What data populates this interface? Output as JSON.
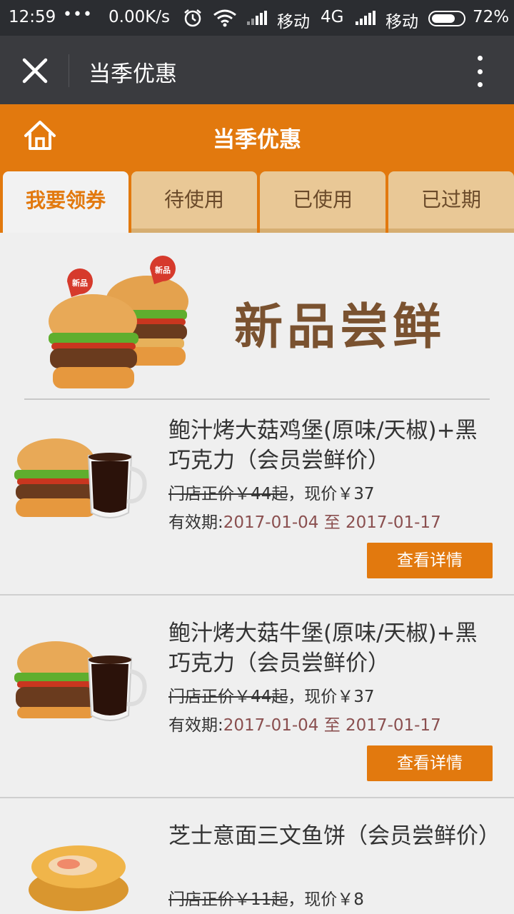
{
  "status_bar": {
    "time": "12:59",
    "dots": "•••",
    "speed": "0.00K/s",
    "carrier1": "移动",
    "network": "4G",
    "carrier2": "移动",
    "battery": "72%"
  },
  "webview": {
    "title": "当季优惠"
  },
  "page_header": {
    "title": "当季优惠"
  },
  "tabs": [
    {
      "label": "我要领券",
      "active": true
    },
    {
      "label": "待使用",
      "active": false
    },
    {
      "label": "已使用",
      "active": false
    },
    {
      "label": "已过期",
      "active": false
    }
  ],
  "banner": {
    "text": "新品尝鲜",
    "badge": "新品"
  },
  "products": [
    {
      "name": "鲍汁烤大菇鸡堡(原味/天椒)+黑巧克力（会员尝鲜价）",
      "old_price": "门店正价￥44起",
      "sep": "，",
      "new_price": "现价￥37",
      "validity_label": "有效期:",
      "validity_dates": "2017-01-04 至 2017-01-17",
      "button": "查看详情"
    },
    {
      "name": "鲍汁烤大菇牛堡(原味/天椒)+黑巧克力（会员尝鲜价）",
      "old_price": "门店正价￥44起",
      "sep": "，",
      "new_price": "现价￥37",
      "validity_label": "有效期:",
      "validity_dates": "2017-01-04 至 2017-01-17",
      "button": "查看详情"
    },
    {
      "name": "芝士意面三文鱼饼（会员尝鲜价）",
      "old_price": "门店正价￥11起",
      "sep": "，",
      "new_price": "现价￥8"
    }
  ],
  "colors": {
    "accent": "#e2790e",
    "tab_inactive": "#e9c896",
    "status_bar": "#2b2d31",
    "webview_header": "#3a3b3f",
    "page_bg": "#efefef"
  },
  "icons": [
    "close-icon",
    "more-icon",
    "home-icon",
    "alarm-icon",
    "wifi-icon",
    "signal-icon",
    "battery-icon"
  ]
}
